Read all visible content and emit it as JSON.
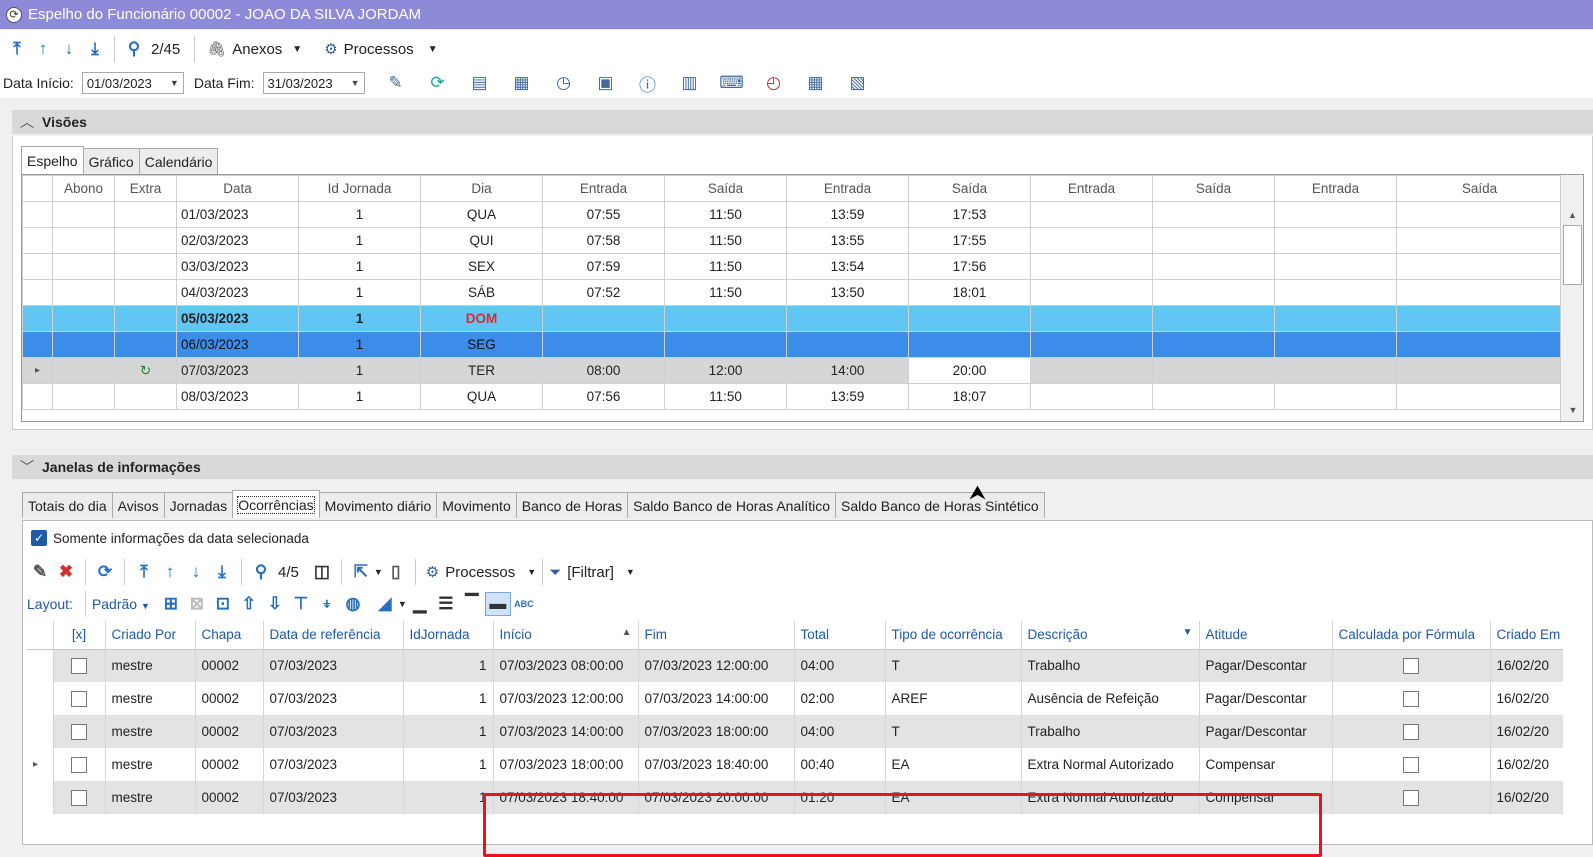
{
  "window": {
    "title": "Espelho do Funcionário 00002 - JOAO DA SILVA JORDAM"
  },
  "toolbar1": {
    "counter": "2/45",
    "anexos": "Anexos",
    "processos": "Processos"
  },
  "toolbar2": {
    "data_inicio_label": "Data Início:",
    "data_inicio": "01/03/2023",
    "data_fim_label": "Data Fim:",
    "data_fim": "31/03/2023"
  },
  "visoes": {
    "title": "Visões",
    "tabs": [
      "Espelho",
      "Gráfico",
      "Calendário"
    ],
    "columns": [
      "Abono",
      "Extra",
      "Data",
      "Id Jornada",
      "Dia",
      "Entrada",
      "Saída",
      "Entrada",
      "Saída",
      "Entrada",
      "Saída",
      "Entrada",
      "Saída"
    ],
    "rows": [
      {
        "data": "01/03/2023",
        "id": "1",
        "dia": "QUA",
        "e1": "07:55",
        "s1": "11:50",
        "e2": "13:59",
        "s2": "17:53"
      },
      {
        "data": "02/03/2023",
        "id": "1",
        "dia": "QUI",
        "e1": "07:58",
        "s1": "11:50",
        "e2": "13:55",
        "s2": "17:55"
      },
      {
        "data": "03/03/2023",
        "id": "1",
        "dia": "SEX",
        "e1": "07:59",
        "s1": "11:50",
        "e2": "13:54",
        "s2": "17:56"
      },
      {
        "data": "04/03/2023",
        "id": "1",
        "dia": "SÁB",
        "e1": "07:52",
        "s1": "11:50",
        "e2": "13:50",
        "s2": "18:01"
      },
      {
        "data": "05/03/2023",
        "id": "1",
        "dia": "DOM",
        "e1": "",
        "s1": "",
        "e2": "",
        "s2": ""
      },
      {
        "data": "06/03/2023",
        "id": "1",
        "dia": "SEG",
        "e1": "",
        "s1": "",
        "e2": "",
        "s2": ""
      },
      {
        "data": "07/03/2023",
        "id": "1",
        "dia": "TER",
        "e1": "08:00",
        "s1": "12:00",
        "e2": "14:00",
        "s2": "20:00"
      },
      {
        "data": "08/03/2023",
        "id": "1",
        "dia": "QUA",
        "e1": "07:56",
        "s1": "11:50",
        "e2": "13:59",
        "s2": "18:07"
      }
    ]
  },
  "janelas": {
    "title": "Janelas de informações",
    "tabs": [
      "Totais do dia",
      "Avisos",
      "Jornadas",
      "Ocorrências",
      "Movimento diário",
      "Movimento",
      "Banco de Horas",
      "Saldo Banco de Horas Analítico",
      "Saldo Banco de Horas Sintético"
    ],
    "checkbox_label": "Somente informações da data selecionada",
    "toolbar": {
      "counter": "4/5",
      "processos": "Processos",
      "filtrar": "[Filtrar]",
      "layout_label": "Layout:",
      "layout_value": "Padrão"
    },
    "columns": [
      "[x]",
      "Criado Por",
      "Chapa",
      "Data de referência",
      "IdJornada",
      "Início",
      "Fim",
      "Total",
      "Tipo de ocorrência",
      "Descrição",
      "Atitude",
      "Calculada por Fórmula",
      "Criado Em"
    ],
    "rows": [
      {
        "criado": "mestre",
        "chapa": "00002",
        "dataref": "07/03/2023",
        "idj": "1",
        "inicio": "07/03/2023 08:00:00",
        "fim": "07/03/2023 12:00:00",
        "total": "04:00",
        "tipo": "T",
        "desc": "Trabalho",
        "atitude": "Pagar/Descontar",
        "criadoem": "16/02/20"
      },
      {
        "criado": "mestre",
        "chapa": "00002",
        "dataref": "07/03/2023",
        "idj": "1",
        "inicio": "07/03/2023 12:00:00",
        "fim": "07/03/2023 14:00:00",
        "total": "02:00",
        "tipo": "AREF",
        "desc": "Ausência de Refeição",
        "atitude": "Pagar/Descontar",
        "criadoem": "16/02/20"
      },
      {
        "criado": "mestre",
        "chapa": "00002",
        "dataref": "07/03/2023",
        "idj": "1",
        "inicio": "07/03/2023 14:00:00",
        "fim": "07/03/2023 18:00:00",
        "total": "04:00",
        "tipo": "T",
        "desc": "Trabalho",
        "atitude": "Pagar/Descontar",
        "criadoem": "16/02/20"
      },
      {
        "criado": "mestre",
        "chapa": "00002",
        "dataref": "07/03/2023",
        "idj": "1",
        "inicio": "07/03/2023 18:00:00",
        "fim": "07/03/2023 18:40:00",
        "total": "00:40",
        "tipo": "EA",
        "desc": "Extra Normal Autorizado",
        "atitude": "Compensar",
        "criadoem": "16/02/20"
      },
      {
        "criado": "mestre",
        "chapa": "00002",
        "dataref": "07/03/2023",
        "idj": "1",
        "inicio": "07/03/2023 18:40:00",
        "fim": "07/03/2023 20:00:00",
        "total": "01:20",
        "tipo": "EA",
        "desc": "Extra Normal Autorizado",
        "atitude": "Compensar",
        "criadoem": "16/02/20"
      }
    ]
  },
  "colors": {
    "titlebar": "#8d8bd9",
    "selected_row": "#62c6f5",
    "focused_row": "#3b8de9",
    "highlight_box": "#e8141a"
  }
}
